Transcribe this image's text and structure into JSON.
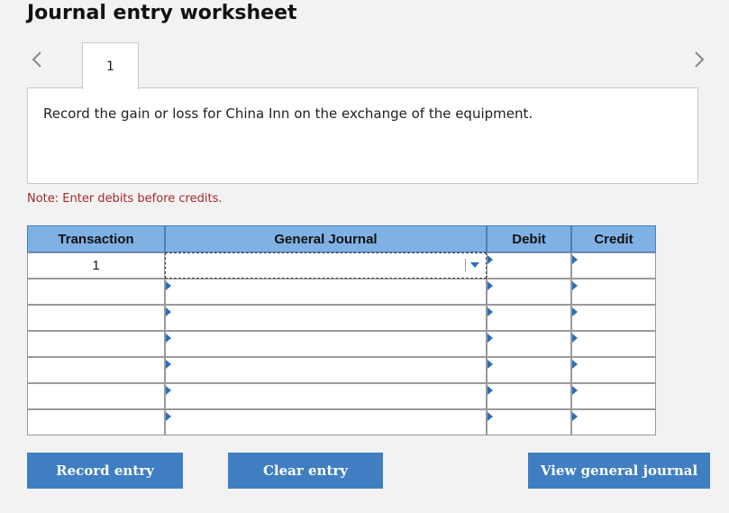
{
  "page": {
    "title": "Journal entry worksheet",
    "accent_color": "#3f7ec1",
    "header_color": "#7fb1e5",
    "note_color": "#a52a2a"
  },
  "tabs": [
    {
      "label": "1",
      "active": true
    }
  ],
  "prompt": {
    "text": "Record the gain or loss for China Inn on the exchange of the equipment."
  },
  "note": "Note: Enter debits before credits.",
  "table": {
    "columns": [
      "Transaction",
      "General Journal",
      "Debit",
      "Credit"
    ],
    "rows": [
      {
        "transaction": "1",
        "general_journal": "",
        "debit": "",
        "credit": ""
      },
      {
        "transaction": "",
        "general_journal": "",
        "debit": "",
        "credit": ""
      },
      {
        "transaction": "",
        "general_journal": "",
        "debit": "",
        "credit": ""
      },
      {
        "transaction": "",
        "general_journal": "",
        "debit": "",
        "credit": ""
      },
      {
        "transaction": "",
        "general_journal": "",
        "debit": "",
        "credit": ""
      },
      {
        "transaction": "",
        "general_journal": "",
        "debit": "",
        "credit": ""
      },
      {
        "transaction": "",
        "general_journal": "",
        "debit": "",
        "credit": ""
      }
    ]
  },
  "buttons": {
    "record": "Record entry",
    "clear": "Clear entry",
    "view": "View general journal"
  },
  "icons": {
    "prev": "chevron-left-icon",
    "next": "chevron-right-icon",
    "dropdown": "caret-down-icon",
    "row_marker": "triangle-right-icon"
  }
}
